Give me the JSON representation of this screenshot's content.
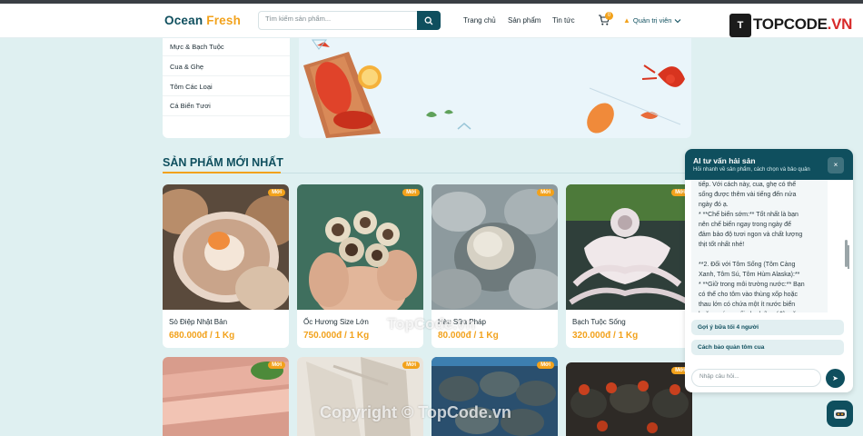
{
  "header": {
    "brand_part1": "Ocean",
    "brand_part2": "Fresh",
    "search_placeholder": "Tìm kiếm sản phẩm...",
    "nav": [
      "Trang chủ",
      "Sản phẩm",
      "Tin tức"
    ],
    "cart_count": "0",
    "admin_label": "Quản trị viên",
    "logo_text": "TOPCODE",
    "logo_suffix": ".VN",
    "logo_mark": "T"
  },
  "categories": [
    "Mực & Bạch Tuộc",
    "Cua & Ghẹ",
    "Tôm Các Loại",
    "Cá Biển Tươi"
  ],
  "section": {
    "title": "SẢN PHẨM MỚI NHẤT"
  },
  "products": [
    {
      "name": "Sò Điệp Nhật Bản",
      "price": "680.000đ / 1 Kg",
      "badge": "Mới"
    },
    {
      "name": "Ốc Hương Size Lớn",
      "price": "750.000đ / 1 Kg",
      "badge": "Mới"
    },
    {
      "name": "Hàu Sữa Pháp",
      "price": "80.000đ / 1 Kg",
      "badge": "Mới"
    },
    {
      "name": "Bạch Tuộc Sống",
      "price": "320.000đ / 1 Kg",
      "badge": "Mới"
    }
  ],
  "products_row2": [
    {
      "badge": "Mới"
    },
    {
      "badge": "Mới"
    },
    {
      "badge": "Mới"
    },
    {
      "badge": "Mới"
    }
  ],
  "chat": {
    "title": "AI tư vấn hải sản",
    "subtitle": "Hỏi nhanh về sản phẩm, cách chọn và bảo quản",
    "close": "×",
    "message": "tiếp. Với cách này, cua, ghẹ có thể\nsống được thêm vài tiếng đến nửa\nngày đó ạ.\n* **Chế biến sớm:** Tốt nhất là bạn\nnên chế biến ngay trong ngày để\nđảm bảo độ tươi ngon và chất lượng\nthịt tốt nhất nhé!\n\n**2. Đối với Tôm Sống (Tôm Càng\nXanh, Tôm Sú, Tôm Hùm Alaska):**\n* **Giữ trong môi trường nước:** Bạn\ncó thể cho tôm vào thùng xốp hoặc\nthau lớn có chứa một ít nước biển\nhoặc nước muối pha loãng (độ mặn",
    "quick_replies": [
      "Gợi ý bữa tối 4 người",
      "Cách bảo quản tôm cua"
    ],
    "input_placeholder": "Nhập câu hỏi...",
    "send": "➤"
  },
  "watermarks": [
    "TopCode.vn",
    "Copyright © TopCode.vn"
  ],
  "colors": {
    "primary": "#0f4f5e",
    "accent": "#f2a21c",
    "background": "#dff0f1"
  }
}
